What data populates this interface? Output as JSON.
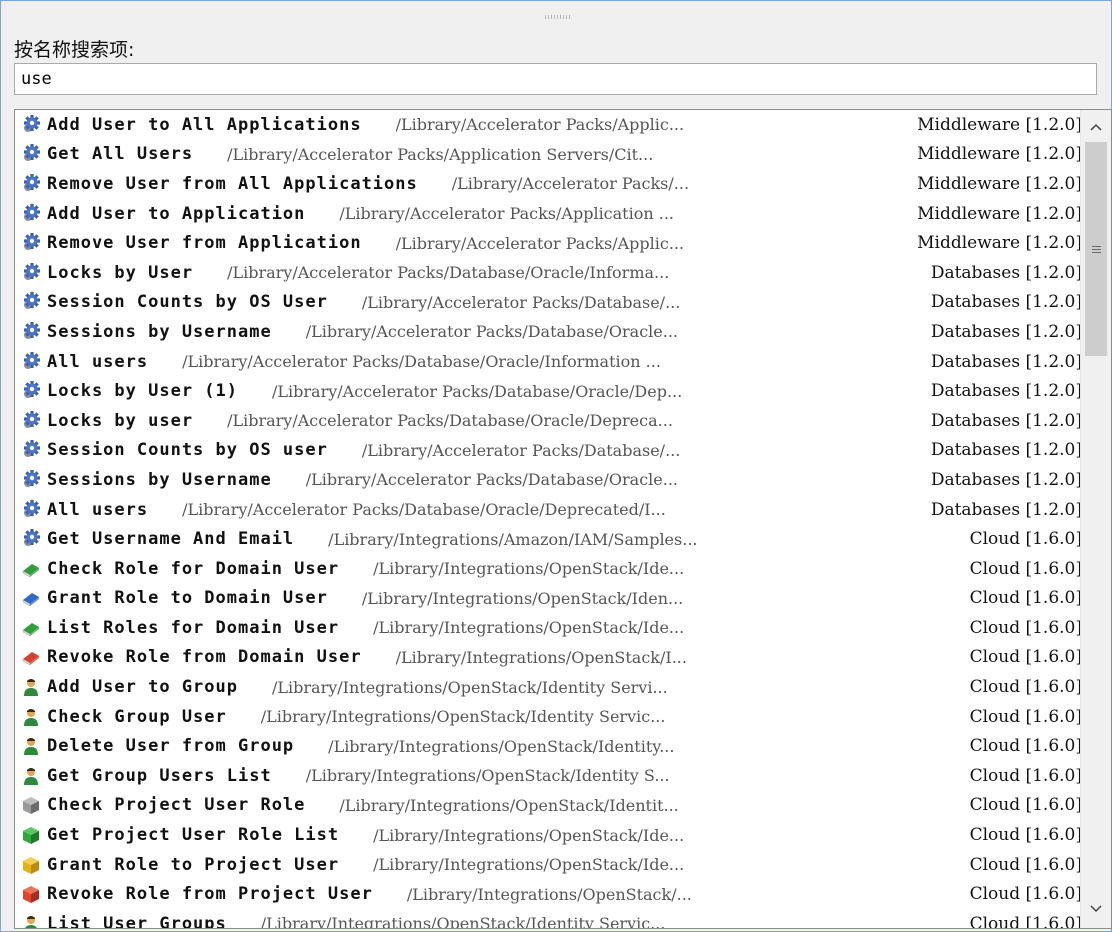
{
  "search": {
    "label": "按名称搜索项:",
    "value": "use"
  },
  "items": [
    {
      "name": "Add User to All Applications",
      "path": "/Library/Accelerator Packs/Applic...",
      "category": "Middleware [1.2.0]",
      "icon": "gear-icon"
    },
    {
      "name": "Get All Users",
      "path": "/Library/Accelerator Packs/Application Servers/Cit...",
      "category": "Middleware [1.2.0]",
      "icon": "gear-icon"
    },
    {
      "name": "Remove User from All Applications",
      "path": "/Library/Accelerator Packs/...",
      "category": "Middleware [1.2.0]",
      "icon": "gear-icon"
    },
    {
      "name": "Add User to Application",
      "path": "/Library/Accelerator Packs/Application ...",
      "category": "Middleware [1.2.0]",
      "icon": "gear-icon"
    },
    {
      "name": "Remove User from Application",
      "path": "/Library/Accelerator Packs/Applic...",
      "category": "Middleware [1.2.0]",
      "icon": "gear-icon"
    },
    {
      "name": "Locks by User",
      "path": "/Library/Accelerator Packs/Database/Oracle/Informa...",
      "category": "Databases [1.2.0]",
      "icon": "gear-icon"
    },
    {
      "name": "Session Counts by OS User",
      "path": "/Library/Accelerator Packs/Database/...",
      "category": "Databases [1.2.0]",
      "icon": "gear-icon"
    },
    {
      "name": "Sessions by Username",
      "path": "/Library/Accelerator Packs/Database/Oracle...",
      "category": "Databases [1.2.0]",
      "icon": "gear-icon"
    },
    {
      "name": "All users",
      "path": "/Library/Accelerator Packs/Database/Oracle/Information ...",
      "category": "Databases [1.2.0]",
      "icon": "gear-icon"
    },
    {
      "name": "Locks by User (1)",
      "path": "/Library/Accelerator Packs/Database/Oracle/Dep...",
      "category": "Databases [1.2.0]",
      "icon": "gear-icon"
    },
    {
      "name": "Locks by user",
      "path": "/Library/Accelerator Packs/Database/Oracle/Depreca...",
      "category": "Databases [1.2.0]",
      "icon": "gear-icon"
    },
    {
      "name": "Session Counts by OS user",
      "path": "/Library/Accelerator Packs/Database/...",
      "category": "Databases [1.2.0]",
      "icon": "gear-icon"
    },
    {
      "name": "Sessions by Username",
      "path": "/Library/Accelerator Packs/Database/Oracle...",
      "category": "Databases [1.2.0]",
      "icon": "gear-icon"
    },
    {
      "name": "All users",
      "path": "/Library/Accelerator Packs/Database/Oracle/Deprecated/I...",
      "category": "Databases [1.2.0]",
      "icon": "gear-icon"
    },
    {
      "name": "Get Username And Email",
      "path": "/Library/Integrations/Amazon/IAM/Samples...",
      "category": "Cloud [1.6.0]",
      "icon": "gear-icon"
    },
    {
      "name": "Check Role for Domain User",
      "path": "/Library/Integrations/OpenStack/Ide...",
      "category": "Cloud [1.6.0]",
      "icon": "green-book-icon"
    },
    {
      "name": "Grant Role to Domain User",
      "path": "/Library/Integrations/OpenStack/Iden...",
      "category": "Cloud [1.6.0]",
      "icon": "blue-book-icon"
    },
    {
      "name": "List Roles for Domain User",
      "path": "/Library/Integrations/OpenStack/Ide...",
      "category": "Cloud [1.6.0]",
      "icon": "green-book-icon"
    },
    {
      "name": "Revoke Role from Domain User",
      "path": "/Library/Integrations/OpenStack/I...",
      "category": "Cloud [1.6.0]",
      "icon": "red-book-icon"
    },
    {
      "name": "Add User to Group",
      "path": "/Library/Integrations/OpenStack/Identity Servi...",
      "category": "Cloud [1.6.0]",
      "icon": "user-icon"
    },
    {
      "name": "Check Group User",
      "path": "/Library/Integrations/OpenStack/Identity Servic...",
      "category": "Cloud [1.6.0]",
      "icon": "user-icon"
    },
    {
      "name": "Delete User from Group",
      "path": "/Library/Integrations/OpenStack/Identity...",
      "category": "Cloud [1.6.0]",
      "icon": "user-icon"
    },
    {
      "name": "Get Group Users List",
      "path": "/Library/Integrations/OpenStack/Identity S...",
      "category": "Cloud [1.6.0]",
      "icon": "user-icon"
    },
    {
      "name": "Check Project User Role",
      "path": "/Library/Integrations/OpenStack/Identit...",
      "category": "Cloud [1.6.0]",
      "icon": "gray-cube-icon"
    },
    {
      "name": "Get Project User Role List",
      "path": "/Library/Integrations/OpenStack/Ide...",
      "category": "Cloud [1.6.0]",
      "icon": "green-cube-icon"
    },
    {
      "name": "Grant Role to Project User",
      "path": "/Library/Integrations/OpenStack/Ide...",
      "category": "Cloud [1.6.0]",
      "icon": "yellow-cube-icon"
    },
    {
      "name": "Revoke Role from Project User",
      "path": "/Library/Integrations/OpenStack/...",
      "category": "Cloud [1.6.0]",
      "icon": "red-cube-icon"
    },
    {
      "name": "List User Groups",
      "path": "/Library/Integrations/OpenStack/Identity Servic...",
      "category": "Cloud [1.6.0]",
      "icon": "user-icon"
    }
  ],
  "colors": {
    "window_border": "#7aa7d9",
    "background": "#f0f0f0",
    "list_background": "#ffffff"
  }
}
